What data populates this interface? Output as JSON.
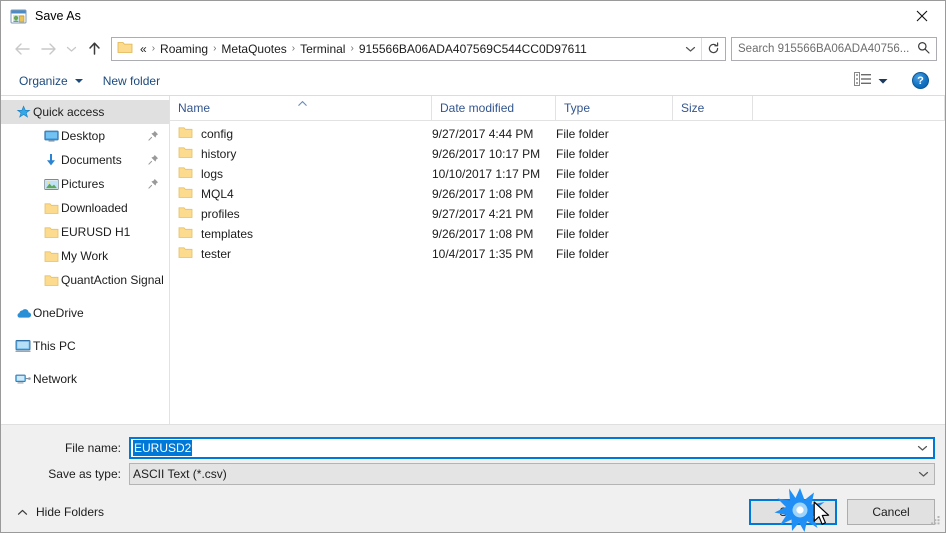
{
  "window": {
    "title": "Save As",
    "app_icon": "save-as-icon",
    "close_label": "×"
  },
  "nav": {
    "back": "back-arrow",
    "forward": "forward-arrow",
    "recent": "recent-locations-chevron",
    "up": "up-arrow",
    "breadcrumbs": [
      "«",
      "Roaming",
      "MetaQuotes",
      "Terminal",
      "915566BA06ADA407569C544CC0D97611"
    ],
    "separator": "›",
    "dropdown": "chevron-down-icon",
    "refresh": "refresh-icon"
  },
  "search": {
    "placeholder": "Search 915566BA06ADA40756...",
    "icon": "search-icon"
  },
  "toolbar": {
    "organize_label": "Organize",
    "new_folder_label": "New folder",
    "view_icon": "view-mode-icon",
    "view_caret": "chevron-down-icon",
    "help_label": "?"
  },
  "sidebar": {
    "items": [
      {
        "label": "Quick access",
        "icon": "star-icon",
        "level": "root",
        "selected": true,
        "pinned": false
      },
      {
        "label": "Desktop",
        "icon": "desktop-icon",
        "level": "child",
        "selected": false,
        "pinned": true
      },
      {
        "label": "Documents",
        "icon": "documents-icon",
        "level": "child",
        "selected": false,
        "pinned": true
      },
      {
        "label": "Pictures",
        "icon": "pictures-icon",
        "level": "child",
        "selected": false,
        "pinned": true
      },
      {
        "label": "Downloaded",
        "icon": "folder-icon",
        "level": "child",
        "selected": false,
        "pinned": false
      },
      {
        "label": "EURUSD H1",
        "icon": "folder-icon",
        "level": "child",
        "selected": false,
        "pinned": false
      },
      {
        "label": "My Work",
        "icon": "folder-icon",
        "level": "child",
        "selected": false,
        "pinned": false
      },
      {
        "label": "QuantAction Signal",
        "icon": "folder-icon",
        "level": "child",
        "selected": false,
        "pinned": false
      },
      {
        "label": "OneDrive",
        "icon": "onedrive-icon",
        "level": "root",
        "selected": false,
        "pinned": false,
        "gap_before": true
      },
      {
        "label": "This PC",
        "icon": "thispc-icon",
        "level": "root",
        "selected": false,
        "pinned": false,
        "gap_before": true
      },
      {
        "label": "Network",
        "icon": "network-icon",
        "level": "root",
        "selected": false,
        "pinned": false,
        "gap_before": true
      }
    ]
  },
  "filelist": {
    "columns": [
      "Name",
      "Date modified",
      "Type",
      "Size"
    ],
    "sort_column": "Name",
    "sort_direction": "ascending",
    "rows": [
      {
        "name": "config",
        "date": "9/27/2017 4:44 PM",
        "type": "File folder",
        "size": ""
      },
      {
        "name": "history",
        "date": "9/26/2017 10:17 PM",
        "type": "File folder",
        "size": ""
      },
      {
        "name": "logs",
        "date": "10/10/2017 1:17 PM",
        "type": "File folder",
        "size": ""
      },
      {
        "name": "MQL4",
        "date": "9/26/2017 1:08 PM",
        "type": "File folder",
        "size": ""
      },
      {
        "name": "profiles",
        "date": "9/27/2017 4:21 PM",
        "type": "File folder",
        "size": ""
      },
      {
        "name": "templates",
        "date": "9/26/2017 1:08 PM",
        "type": "File folder",
        "size": ""
      },
      {
        "name": "tester",
        "date": "10/4/2017 1:35 PM",
        "type": "File folder",
        "size": ""
      }
    ]
  },
  "form": {
    "filename_label": "File name:",
    "filename_value": "EURUSD2",
    "filetype_label": "Save as type:",
    "filetype_value": "ASCII Text (*.csv)"
  },
  "footer": {
    "hide_folders_label": "Hide Folders",
    "hide_folders_caret": "chevron-up-icon",
    "save_label": "Save",
    "cancel_label": "Cancel",
    "resize_grip": "resize-grip-icon"
  },
  "colors": {
    "accent": "#0078d7",
    "folder": "#fcdb8e",
    "column_header_text": "#33558f",
    "breadcrumb_text": "#1c1c1c",
    "burst": "#1f8ff5"
  }
}
